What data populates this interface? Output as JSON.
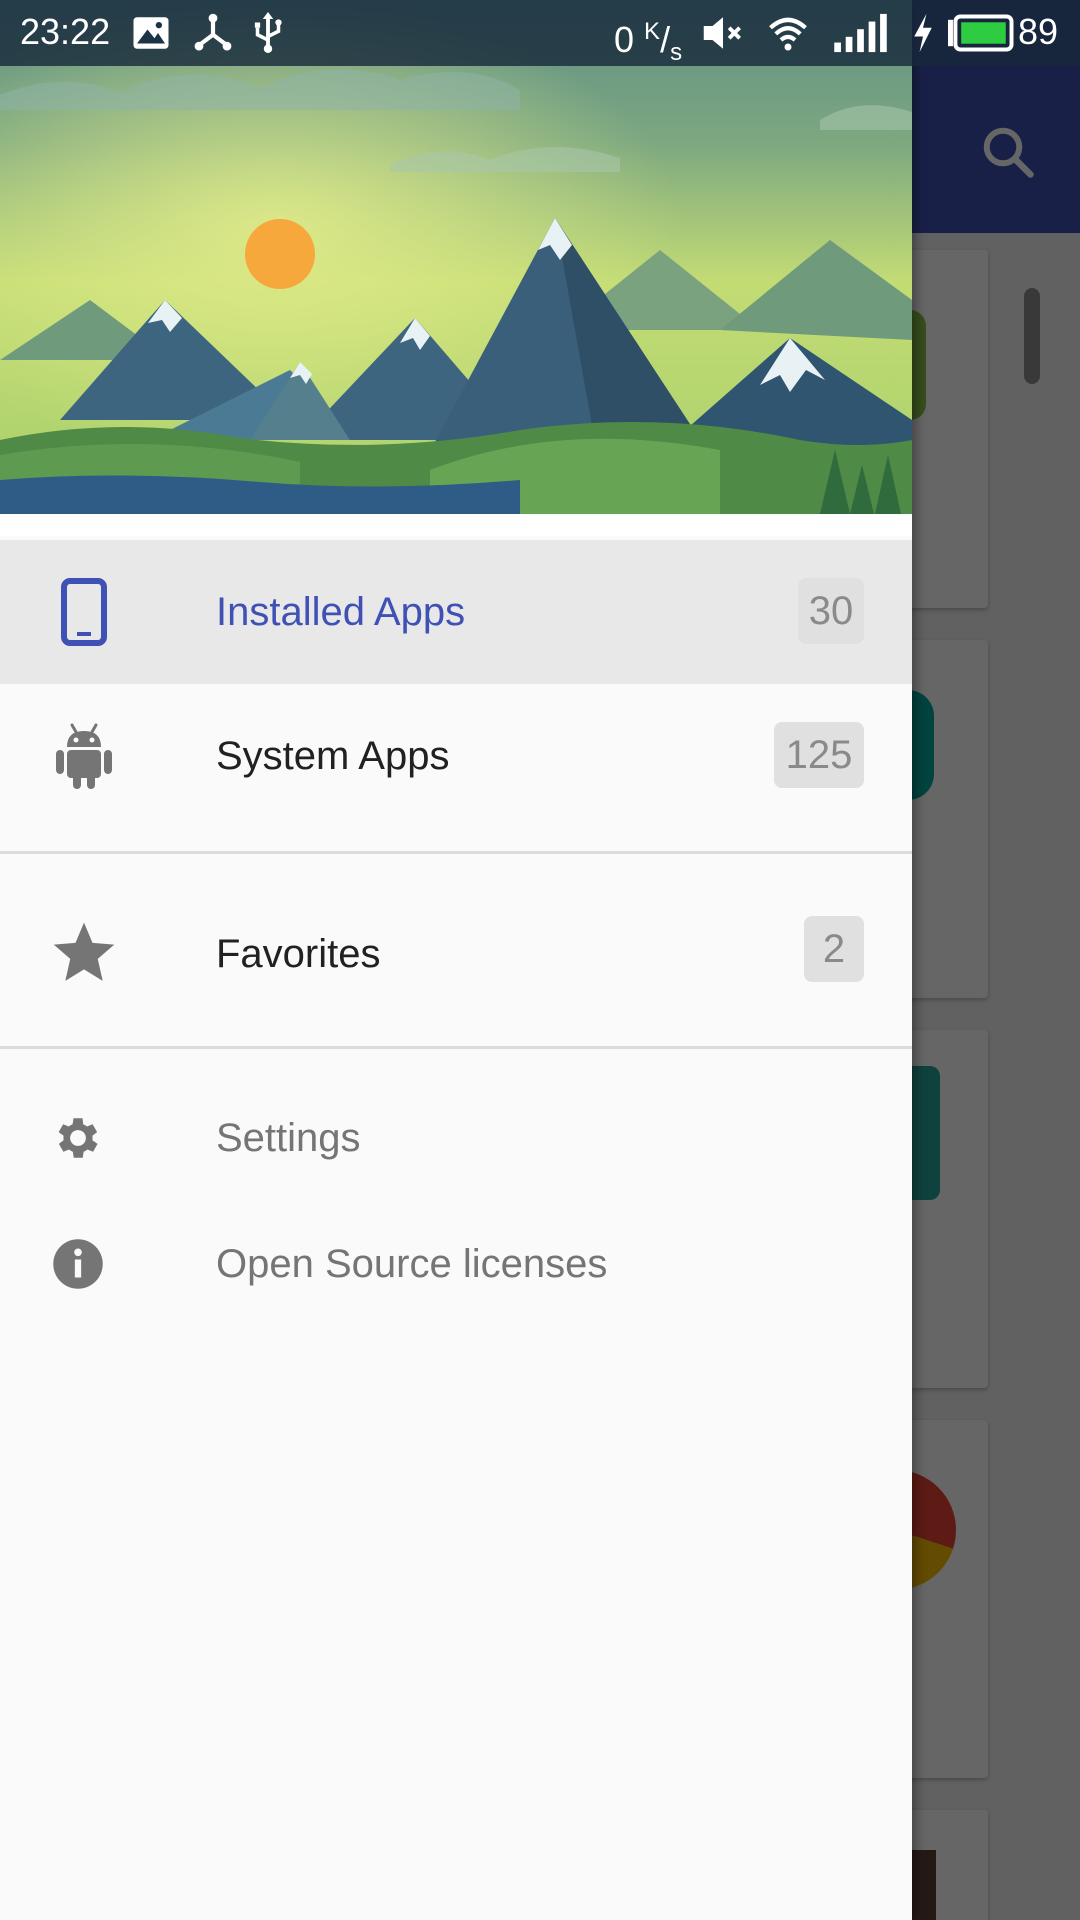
{
  "status_bar": {
    "time": "23:22",
    "net_speed_value": "0",
    "net_speed_unit_top": "K",
    "net_speed_unit_bottom": "s",
    "battery_percent": "89",
    "icons": [
      "image-icon",
      "share-hub-icon",
      "usb-icon",
      "mute-icon",
      "wifi-icon",
      "signal-icon",
      "charging-icon",
      "battery-icon"
    ]
  },
  "app_bar": {
    "action_icon": "search-icon"
  },
  "drawer": {
    "header_image": "mountain-landscape",
    "primary": [
      {
        "icon": "phone-icon",
        "label": "Installed Apps",
        "count": "30",
        "active": true
      },
      {
        "icon": "android-icon",
        "label": "System Apps",
        "count": "125",
        "active": false
      }
    ],
    "favorites": {
      "icon": "star-icon",
      "label": "Favorites",
      "count": "2"
    },
    "secondary": [
      {
        "icon": "gear-icon",
        "label": "Settings"
      },
      {
        "icon": "info-icon",
        "label": "Open Source licenses"
      }
    ]
  },
  "colors": {
    "primary": "#3f51b5",
    "active_item_bg": "#e8e8e8",
    "badge_bg": "#e0e0e0",
    "icon_gray": "#757575",
    "battery_green": "#2ecc40"
  }
}
